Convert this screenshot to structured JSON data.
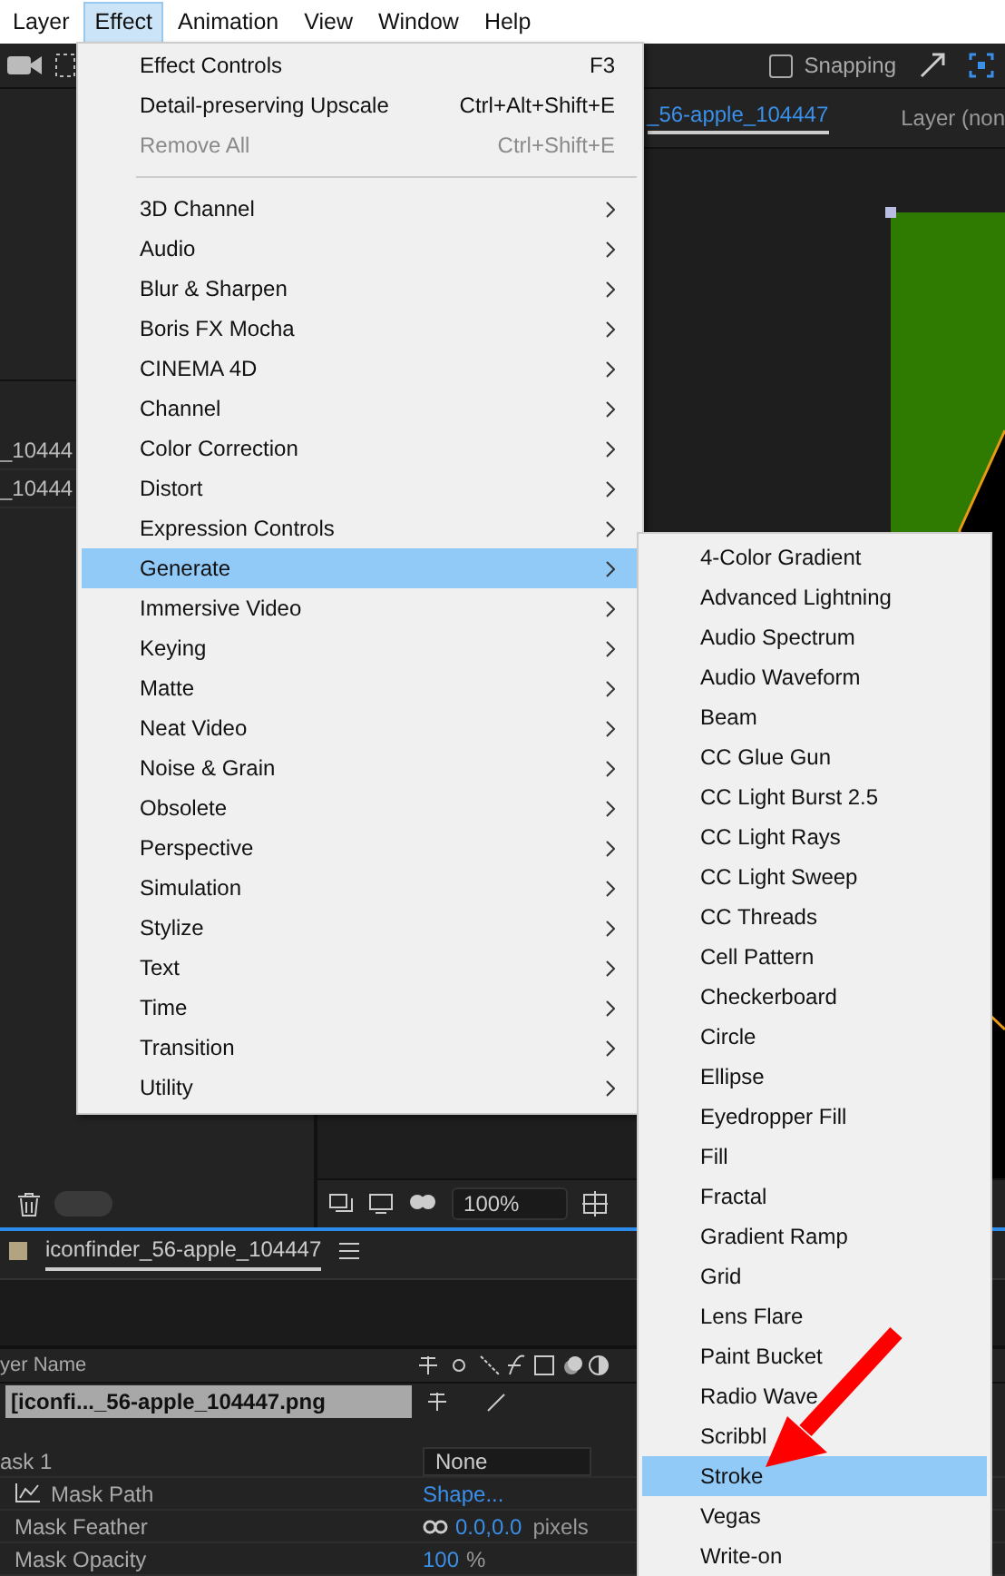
{
  "menubar": [
    {
      "label": "Layer",
      "selected": false
    },
    {
      "label": "Effect",
      "selected": true
    },
    {
      "label": "Animation",
      "selected": false
    },
    {
      "label": "View",
      "selected": false
    },
    {
      "label": "Window",
      "selected": false
    },
    {
      "label": "Help",
      "selected": false
    }
  ],
  "toolbar": {
    "snapping": {
      "label": "Snapping",
      "checked": false
    }
  },
  "project_panel": {
    "rows": [
      "_10444",
      "_10444"
    ]
  },
  "viewer": {
    "tabs": [
      {
        "label": "_56-apple_104447",
        "selected": true
      },
      {
        "label": "Layer (non",
        "selected": false
      }
    ],
    "zoom": "100%"
  },
  "timeline": {
    "tab": "iconfinder_56-apple_104447",
    "column_header": "yer Name",
    "layer": {
      "name": "[iconfi..._56-apple_104447.png",
      "selected": true
    },
    "properties": [
      {
        "kind": "group",
        "label": "ask 1",
        "value": "None"
      },
      {
        "kind": "path",
        "label": "Mask Path",
        "value": "Shape..."
      },
      {
        "kind": "feather",
        "label": "Mask Feather",
        "value": "0.0,0.0",
        "unit": "pixels"
      },
      {
        "kind": "opacity",
        "label": "Mask Opacity",
        "value": "100",
        "unit": "%"
      }
    ]
  },
  "effect_menu": {
    "commands": [
      {
        "label": "Effect Controls",
        "shortcut": "F3",
        "disabled": false
      },
      {
        "label": "Detail-preserving Upscale",
        "shortcut": "Ctrl+Alt+Shift+E",
        "disabled": false
      },
      {
        "label": "Remove All",
        "shortcut": "Ctrl+Shift+E",
        "disabled": true
      }
    ],
    "categories": [
      {
        "label": "3D Channel",
        "selected": false
      },
      {
        "label": "Audio",
        "selected": false
      },
      {
        "label": "Blur & Sharpen",
        "selected": false
      },
      {
        "label": "Boris FX Mocha",
        "selected": false
      },
      {
        "label": "CINEMA 4D",
        "selected": false
      },
      {
        "label": "Channel",
        "selected": false
      },
      {
        "label": "Color Correction",
        "selected": false
      },
      {
        "label": "Distort",
        "selected": false
      },
      {
        "label": "Expression Controls",
        "selected": false
      },
      {
        "label": "Generate",
        "selected": true
      },
      {
        "label": "Immersive Video",
        "selected": false
      },
      {
        "label": "Keying",
        "selected": false
      },
      {
        "label": "Matte",
        "selected": false
      },
      {
        "label": "Neat Video",
        "selected": false
      },
      {
        "label": "Noise & Grain",
        "selected": false
      },
      {
        "label": "Obsolete",
        "selected": false
      },
      {
        "label": "Perspective",
        "selected": false
      },
      {
        "label": "Simulation",
        "selected": false
      },
      {
        "label": "Stylize",
        "selected": false
      },
      {
        "label": "Text",
        "selected": false
      },
      {
        "label": "Time",
        "selected": false
      },
      {
        "label": "Transition",
        "selected": false
      },
      {
        "label": "Utility",
        "selected": false
      }
    ]
  },
  "generate_submenu": {
    "items": [
      {
        "label": "4-Color Gradient",
        "selected": false
      },
      {
        "label": "Advanced Lightning",
        "selected": false
      },
      {
        "label": "Audio Spectrum",
        "selected": false
      },
      {
        "label": "Audio Waveform",
        "selected": false
      },
      {
        "label": "Beam",
        "selected": false
      },
      {
        "label": "CC Glue Gun",
        "selected": false
      },
      {
        "label": "CC Light Burst 2.5",
        "selected": false
      },
      {
        "label": "CC Light Rays",
        "selected": false
      },
      {
        "label": "CC Light Sweep",
        "selected": false
      },
      {
        "label": "CC Threads",
        "selected": false
      },
      {
        "label": "Cell Pattern",
        "selected": false
      },
      {
        "label": "Checkerboard",
        "selected": false
      },
      {
        "label": "Circle",
        "selected": false
      },
      {
        "label": "Ellipse",
        "selected": false
      },
      {
        "label": "Eyedropper Fill",
        "selected": false
      },
      {
        "label": "Fill",
        "selected": false
      },
      {
        "label": "Fractal",
        "selected": false
      },
      {
        "label": "Gradient Ramp",
        "selected": false
      },
      {
        "label": "Grid",
        "selected": false
      },
      {
        "label": "Lens Flare",
        "selected": false
      },
      {
        "label": "Paint Bucket",
        "selected": false
      },
      {
        "label": "Radio Wave",
        "selected": false
      },
      {
        "label": "Scribbl",
        "selected": false
      },
      {
        "label": "Stroke",
        "selected": true
      },
      {
        "label": "Vegas",
        "selected": false
      },
      {
        "label": "Write-on",
        "selected": false
      }
    ]
  }
}
